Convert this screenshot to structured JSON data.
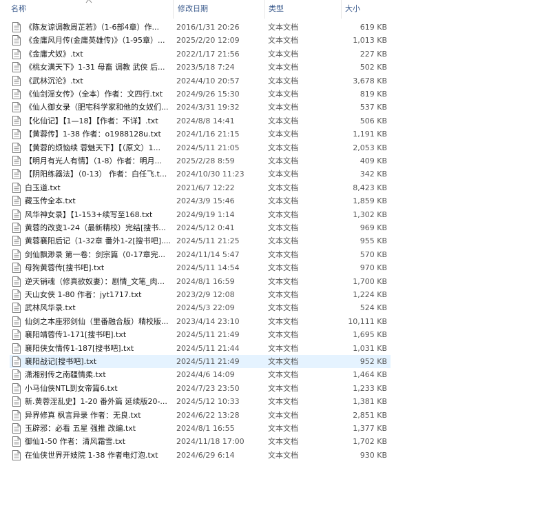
{
  "columns": {
    "name": "名称",
    "date": "修改日期",
    "type": "类型",
    "size": "大小"
  },
  "icons": {
    "file": "text-file-icon",
    "sort": "sort-up-icon"
  },
  "colors": {
    "header_text": "#3a5a8c",
    "selected_row": "#e5f3ff"
  },
  "selected_index": 25,
  "files": [
    {
      "name": "《陈友谅调教周芷若》（1-6部4章）作...",
      "date": "2016/1/31 20:26",
      "type": "文本文档",
      "size": "619 KB"
    },
    {
      "name": "《金庸风月传(金庸英雄传)》（1-95章）...",
      "date": "2025/2/20 12:09",
      "type": "文本文档",
      "size": "1,013 KB"
    },
    {
      "name": "《金庸犬奴》.txt",
      "date": "2022/1/17 21:56",
      "type": "文本文档",
      "size": "227 KB"
    },
    {
      "name": "《桃女满天下》1-31 母畜 调教 武侠 后...",
      "date": "2023/5/18 7:24",
      "type": "文本文档",
      "size": "502 KB"
    },
    {
      "name": "《武林沉沦》.txt",
      "date": "2024/4/10 20:57",
      "type": "文本文档",
      "size": "3,678 KB"
    },
    {
      "name": "《仙剑淫女传》（全本）作者：文四行.txt",
      "date": "2024/9/26 15:30",
      "type": "文本文档",
      "size": "819 KB"
    },
    {
      "name": "《仙人御女录（肥宅科学家和他的女奴们...",
      "date": "2024/3/31 19:32",
      "type": "文本文档",
      "size": "537 KB"
    },
    {
      "name": "【化仙记】【1—18】【作者：不详】.txt",
      "date": "2024/8/8 14:41",
      "type": "文本文档",
      "size": "506 KB"
    },
    {
      "name": "【黄蓉传】1-38 作者：o1988128u.txt",
      "date": "2024/1/16 21:15",
      "type": "文本文档",
      "size": "1,191 KB"
    },
    {
      "name": "【黄蓉的烦恼续 蓉魅天下】【（原文）1...",
      "date": "2024/5/11 21:05",
      "type": "文本文档",
      "size": "2,053 KB"
    },
    {
      "name": "【明月有光人有情】（1-8）作者：明月...",
      "date": "2025/2/28 8:59",
      "type": "文本文档",
      "size": "409 KB"
    },
    {
      "name": "【阴阳练器法】（0-13） 作者：白任飞.t...",
      "date": "2024/10/30 11:23",
      "type": "文本文档",
      "size": "342 KB"
    },
    {
      "name": "白玉道.txt",
      "date": "2021/6/7 12:22",
      "type": "文本文档",
      "size": "8,423 KB"
    },
    {
      "name": "藏玉传全本.txt",
      "date": "2024/3/9 15:46",
      "type": "文本文档",
      "size": "1,859 KB"
    },
    {
      "name": "风华神女录】【1-153+续写至168.txt",
      "date": "2024/9/19 1:14",
      "type": "文本文档",
      "size": "1,302 KB"
    },
    {
      "name": "黄蓉的改变1-24（最新精校）完结[搜书...",
      "date": "2024/5/12 0:41",
      "type": "文本文档",
      "size": "969 KB"
    },
    {
      "name": "黄蓉襄阳后记（1-32章 番外1-2[搜书吧]....",
      "date": "2024/5/11 21:25",
      "type": "文本文档",
      "size": "955 KB"
    },
    {
      "name": "剑仙飘渺录 第一卷：剑宗篇（0-17章完...",
      "date": "2024/11/14 5:47",
      "type": "文本文档",
      "size": "570 KB"
    },
    {
      "name": "母狗黄蓉传[搜书吧].txt",
      "date": "2024/5/11 14:54",
      "type": "文本文档",
      "size": "970 KB"
    },
    {
      "name": "逆天销魂（修真欲奴妻）：剧情_文笔_肉...",
      "date": "2024/8/1 16:59",
      "type": "文本文档",
      "size": "1,700 KB"
    },
    {
      "name": "天山女侠 1-80 作者：jyt1717.txt",
      "date": "2023/2/9 12:08",
      "type": "文本文档",
      "size": "1,224 KB"
    },
    {
      "name": "武林风华录.txt",
      "date": "2024/5/3 22:09",
      "type": "文本文档",
      "size": "524 KB"
    },
    {
      "name": "仙剑之本座邪剑仙（里番融合版）精校版...",
      "date": "2023/4/14 23:10",
      "type": "文本文档",
      "size": "10,111 KB"
    },
    {
      "name": "襄阳靖蓉传1-171[搜书吧].txt",
      "date": "2024/5/11 21:49",
      "type": "文本文档",
      "size": "1,695 KB"
    },
    {
      "name": "襄阳侠女情传1-187[搜书吧].txt",
      "date": "2024/5/11 21:44",
      "type": "文本文档",
      "size": "1,031 KB"
    },
    {
      "name": "襄阳战记[搜书吧].txt",
      "date": "2024/5/11 21:49",
      "type": "文本文档",
      "size": "952 KB"
    },
    {
      "name": "潇湘别传之南疆情柔.txt",
      "date": "2024/4/6 14:09",
      "type": "文本文档",
      "size": "1,464 KB"
    },
    {
      "name": "小马仙侠NTL到女帝篇6.txt",
      "date": "2024/7/23 23:50",
      "type": "文本文档",
      "size": "1,233 KB"
    },
    {
      "name": "新.黄蓉淫乱史】1-20 番外篇 延续版20-...",
      "date": "2024/5/12 10:33",
      "type": "文本文档",
      "size": "1,381 KB"
    },
    {
      "name": "异界修真 枫言异录 作者：无良.txt",
      "date": "2024/6/22 13:28",
      "type": "文本文档",
      "size": "2,851 KB"
    },
    {
      "name": "玉辟邪：必看 五星 强推 改编.txt",
      "date": "2024/8/1 16:55",
      "type": "文本文档",
      "size": "1,377 KB"
    },
    {
      "name": "御仙1-50 作者：清风霜雪.txt",
      "date": "2024/11/18 17:00",
      "type": "文本文档",
      "size": "1,702 KB"
    },
    {
      "name": "在仙侠世界开妓院 1-38 作者电灯泡.txt",
      "date": "2024/6/29 6:14",
      "type": "文本文档",
      "size": "930 KB"
    }
  ]
}
